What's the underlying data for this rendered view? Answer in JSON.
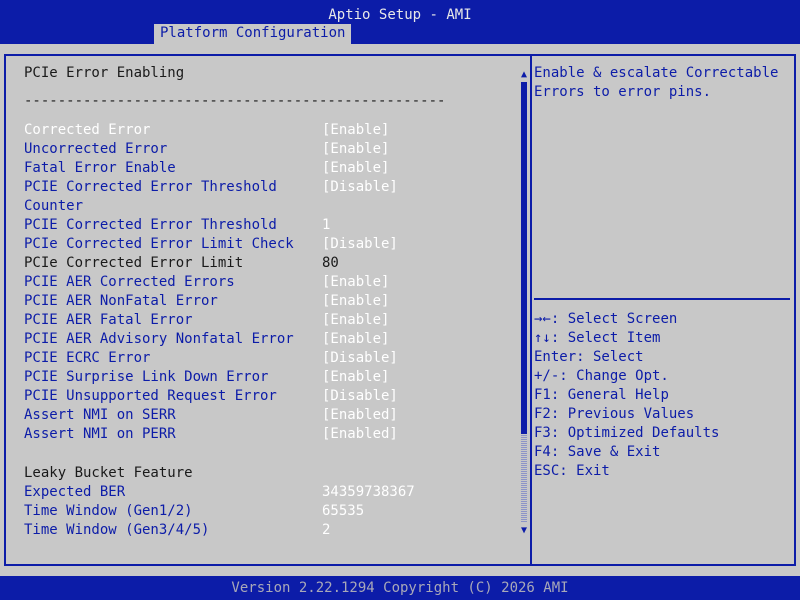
{
  "header": {
    "app_title": "Aptio Setup - AMI",
    "active_tab": "Platform Configuration"
  },
  "main": {
    "section_title": "PCIe Error Enabling",
    "separator": "--------------------------------------------------",
    "items": [
      {
        "label": "Corrected Error",
        "value": "[Enable]",
        "selected": true
      },
      {
        "label": "Uncorrected Error",
        "value": "[Enable]"
      },
      {
        "label": "Fatal Error Enable",
        "value": "[Enable]"
      },
      {
        "label": "PCIE Corrected Error Threshold",
        "value": "[Disable]"
      },
      {
        "label": "Counter",
        "value": ""
      },
      {
        "label": "PCIE Corrected Error Threshold",
        "value": "1"
      },
      {
        "label": "PCIe Corrected Error Limit Check",
        "value": "[Disable]"
      },
      {
        "label": "PCIe Corrected Error Limit",
        "value": "80",
        "readonly": true
      },
      {
        "label": "PCIE AER Corrected Errors",
        "value": "[Enable]"
      },
      {
        "label": "PCIE AER NonFatal Error",
        "value": "[Enable]"
      },
      {
        "label": "PCIE AER Fatal Error",
        "value": "[Enable]"
      },
      {
        "label": "PCIE AER Advisory Nonfatal Error",
        "value": "[Enable]"
      },
      {
        "label": "PCIE ECRC Error",
        "value": "[Disable]"
      },
      {
        "label": "PCIE Surprise Link Down Error",
        "value": "[Enable]"
      },
      {
        "label": "PCIE Unsupported Request Error",
        "value": "[Disable]"
      },
      {
        "label": "Assert NMI on SERR",
        "value": "[Enabled]"
      },
      {
        "label": "Assert NMI on PERR",
        "value": "[Enabled]"
      }
    ],
    "leaky_title": "Leaky Bucket Feature",
    "leaky_items": [
      {
        "label": "Expected BER",
        "value": "34359738367"
      },
      {
        "label": "Time Window (Gen1/2)",
        "value": "65535"
      },
      {
        "label": "Time Window (Gen3/4/5)",
        "value": "2"
      }
    ]
  },
  "help": {
    "text": "Enable & escalate Correctable\nErrors to error pins.",
    "keys": [
      {
        "key": "→←:",
        "desc": " Select Screen"
      },
      {
        "key": "↑↓:",
        "desc": " Select Item"
      },
      {
        "key": "Enter:",
        "desc": " Select"
      },
      {
        "key": "+/-:",
        "desc": " Change Opt."
      },
      {
        "key": "F1:",
        "desc": " General Help"
      },
      {
        "key": "F2:",
        "desc": " Previous Values"
      },
      {
        "key": "F3:",
        "desc": " Optimized Defaults"
      },
      {
        "key": "F4:",
        "desc": " Save & Exit"
      },
      {
        "key": "ESC:",
        "desc": " Exit"
      }
    ]
  },
  "footer": {
    "version": "Version 2.22.1294 Copyright (C) 2026 AMI"
  },
  "colors": {
    "background_blue": "#0c1ca8",
    "panel_gray": "#c8c8c8",
    "selected_white": "#ffffff"
  }
}
